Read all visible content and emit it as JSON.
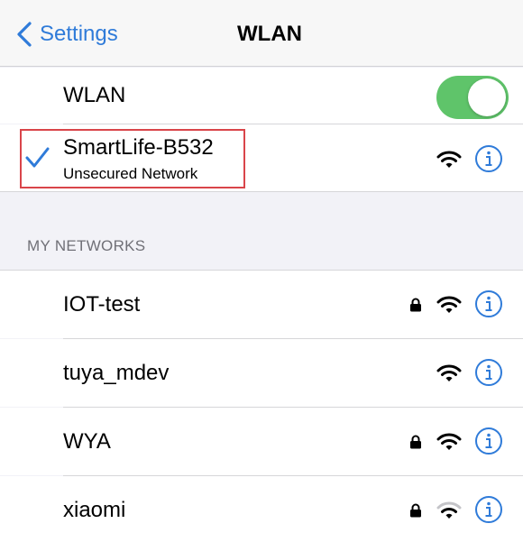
{
  "nav": {
    "back_label": "Settings",
    "title": "WLAN"
  },
  "wlan_toggle": {
    "label": "WLAN",
    "on": true,
    "on_color": "#5fc46a"
  },
  "connected": {
    "ssid": "SmartLife-B532",
    "status": "Unsecured Network",
    "highlight_color": "#d9454a"
  },
  "section": {
    "header": "MY NETWORKS"
  },
  "networks": [
    {
      "ssid": "IOT-test",
      "locked": true,
      "signal": "full"
    },
    {
      "ssid": "tuya_mdev",
      "locked": false,
      "signal": "full"
    },
    {
      "ssid": "WYA",
      "locked": true,
      "signal": "full"
    },
    {
      "ssid": "xiaomi",
      "locked": true,
      "signal": "weak"
    }
  ],
  "colors": {
    "accent": "#2f7bd9"
  }
}
